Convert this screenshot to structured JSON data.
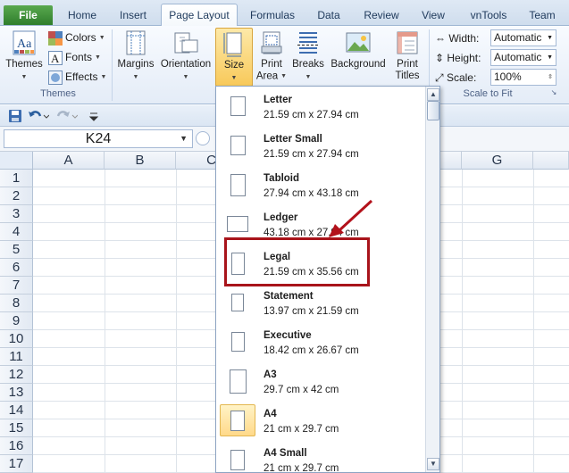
{
  "tabs": [
    {
      "label": "File",
      "id": "file"
    },
    {
      "label": "Home",
      "id": "home"
    },
    {
      "label": "Insert",
      "id": "insert"
    },
    {
      "label": "Page Layout",
      "id": "page-layout"
    },
    {
      "label": "Formulas",
      "id": "formulas"
    },
    {
      "label": "Data",
      "id": "data"
    },
    {
      "label": "Review",
      "id": "review"
    },
    {
      "label": "View",
      "id": "view"
    },
    {
      "label": "vnTools",
      "id": "vntools"
    },
    {
      "label": "Team",
      "id": "team"
    }
  ],
  "ribbon": {
    "themes_group": {
      "label": "Themes",
      "themes_button": "Themes",
      "colors": "Colors",
      "fonts": "Fonts",
      "effects": "Effects"
    },
    "page_setup": {
      "margins": "Margins",
      "orientation": "Orientation",
      "size": "Size",
      "print_area_line1": "Print",
      "print_area_line2": "Area",
      "breaks": "Breaks",
      "background": "Background",
      "print_titles_line1": "Print",
      "print_titles_line2": "Titles"
    },
    "scale_to_fit": {
      "label": "Scale to Fit",
      "width_label": "Width:",
      "width_value": "Automatic",
      "height_label": "Height:",
      "height_value": "Automatic",
      "scale_label": "Scale:",
      "scale_value": "100%"
    }
  },
  "name_box": {
    "value": "K24"
  },
  "grid": {
    "columns": [
      "A",
      "B",
      "C",
      "G"
    ],
    "rows": [
      "1",
      "2",
      "3",
      "4",
      "5",
      "6",
      "7",
      "8",
      "9",
      "10",
      "11",
      "12",
      "13",
      "14",
      "15",
      "16",
      "17"
    ]
  },
  "size_menu": {
    "items": [
      {
        "name": "Letter",
        "dims": "21.59 cm x 27.94 cm"
      },
      {
        "name": "Letter Small",
        "dims": "21.59 cm x 27.94 cm"
      },
      {
        "name": "Tabloid",
        "dims": "27.94 cm x 43.18 cm"
      },
      {
        "name": "Ledger",
        "dims": "43.18 cm x 27.94 cm"
      },
      {
        "name": "Legal",
        "dims": "21.59 cm x 35.56 cm"
      },
      {
        "name": "Statement",
        "dims": "13.97 cm x 21.59 cm"
      },
      {
        "name": "Executive",
        "dims": "18.42 cm x 26.67 cm"
      },
      {
        "name": "A3",
        "dims": "29.7 cm x 42 cm"
      },
      {
        "name": "A4",
        "dims": "21 cm x 29.7 cm"
      },
      {
        "name": "A4 Small",
        "dims": "21 cm x 29.7 cm"
      }
    ],
    "selected": "A4",
    "highlighted": "Legal"
  },
  "colors": {
    "file_tab": "#3c8d37",
    "annotation": "#a8141b",
    "selected_item": "#ffd98a"
  }
}
